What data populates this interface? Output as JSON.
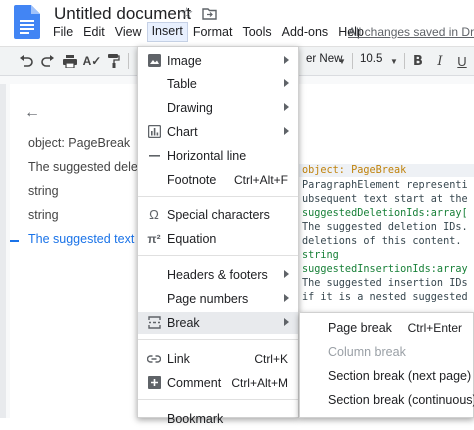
{
  "app": {
    "doc_title": "Untitled document",
    "save_status": "All changes saved in Drive"
  },
  "menubar": [
    "File",
    "Edit",
    "View",
    "Insert",
    "Format",
    "Tools",
    "Add-ons",
    "Help"
  ],
  "toolbar": {
    "font_name": "er New",
    "font_size": "10.5"
  },
  "outline": {
    "items": [
      "object: PageBreak",
      "The suggested deletio",
      "string",
      "string",
      "The suggested text s"
    ]
  },
  "code": {
    "lines": [
      "object: PageBreak",
      " ParagraphElement representi",
      "ubsequent text start at the",
      "suggestedDeletionIds:array[",
      "The suggested deletion IDs.",
      "deletions of this content.",
      " string",
      "suggestedInsertionIds:array",
      "The suggested insertion IDs",
      "if it is a nested suggested"
    ]
  },
  "insert_menu": {
    "items": [
      {
        "label": "Image",
        "icon": "image-icon",
        "submenu": true
      },
      {
        "label": "Table",
        "submenu": true
      },
      {
        "label": "Drawing",
        "submenu": true
      },
      {
        "label": "Chart",
        "icon": "chart-icon",
        "submenu": true
      },
      {
        "label": "Horizontal line",
        "icon": "horizontal-line-icon"
      },
      {
        "label": "Footnote",
        "shortcut": "Ctrl+Alt+F"
      },
      {
        "label": "Special characters",
        "icon": "omega-icon"
      },
      {
        "label": "Equation",
        "icon": "pi-icon"
      },
      {
        "label": "Headers & footers",
        "submenu": true
      },
      {
        "label": "Page numbers",
        "submenu": true
      },
      {
        "label": "Break",
        "icon": "break-icon",
        "submenu": true
      },
      {
        "label": "Link",
        "icon": "link-icon",
        "shortcut": "Ctrl+K"
      },
      {
        "label": "Comment",
        "icon": "comment-icon",
        "shortcut": "Ctrl+Alt+M"
      },
      {
        "label": "Bookmark"
      }
    ]
  },
  "break_submenu": {
    "items": [
      {
        "label": "Page break",
        "shortcut": "Ctrl+Enter",
        "disabled": false
      },
      {
        "label": "Column break",
        "disabled": true
      },
      {
        "label": "Section break (next page)",
        "disabled": false
      },
      {
        "label": "Section break (continuous)",
        "disabled": false
      }
    ]
  },
  "colors": {
    "accent": "#1a73e8",
    "docs_blue": "#4285f4",
    "menu_hover": "#e8eaed",
    "code_keyword": "#c0820b",
    "code_type": "#188038"
  }
}
